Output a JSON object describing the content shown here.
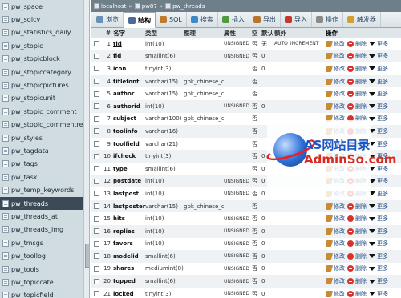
{
  "sidebar": {
    "items": [
      "pw_space",
      "pw_sqlcv",
      "pw_statistics_daily",
      "pw_stopic",
      "pw_stopicblock",
      "pw_stopiccategory",
      "pw_stopicpictures",
      "pw_stopicunit",
      "pw_stopic_comment",
      "pw_stopic_commentre",
      "pw_styles",
      "pw_tagdata",
      "pw_tags",
      "pw_task",
      "pw_temp_keywords",
      "pw_threads",
      "pw_threads_at",
      "pw_threads_img",
      "pw_tmsgs",
      "pw_toollog",
      "pw_tools",
      "pw_topiccate",
      "pw_topicfield"
    ],
    "selected_index": 15
  },
  "breadcrumb": {
    "server": "localhost",
    "database": "pw87",
    "table": "pw_threads",
    "sep": "»"
  },
  "tabs": [
    "浏览",
    "结构",
    "SQL",
    "搜索",
    "插入",
    "导出",
    "导入",
    "操作",
    "触发器"
  ],
  "active_tab": 1,
  "columns": {
    "num": "#",
    "name": "名字",
    "type": "类型",
    "collation": "整理",
    "attributes": "属性",
    "null": "空",
    "default": "默认",
    "extra": "额外",
    "action": "操作"
  },
  "actions": {
    "edit": "修改",
    "delete": "删除",
    "more": "更多"
  },
  "rows": [
    {
      "num": "1",
      "name": "tid",
      "type": "int(10)",
      "coll": "",
      "attr": "UNSIGNED",
      "null": "否",
      "def": "无",
      "extra": "AUTO_INCREMENT"
    },
    {
      "num": "2",
      "name": "fid",
      "type": "smallint(6)",
      "coll": "",
      "attr": "UNSIGNED",
      "null": "否",
      "def": "0",
      "extra": ""
    },
    {
      "num": "3",
      "name": "icon",
      "type": "tinyint(3)",
      "coll": "",
      "attr": "",
      "null": "否",
      "def": "0",
      "extra": ""
    },
    {
      "num": "4",
      "name": "titlefont",
      "type": "varchar(15)",
      "coll": "gbk_chinese_ci",
      "attr": "",
      "null": "否",
      "def": "",
      "extra": ""
    },
    {
      "num": "5",
      "name": "author",
      "type": "varchar(15)",
      "coll": "gbk_chinese_ci",
      "attr": "",
      "null": "否",
      "def": "",
      "extra": ""
    },
    {
      "num": "6",
      "name": "authorid",
      "type": "int(10)",
      "coll": "",
      "attr": "UNSIGNED",
      "null": "否",
      "def": "0",
      "extra": ""
    },
    {
      "num": "7",
      "name": "subject",
      "type": "varchar(100)",
      "coll": "gbk_chinese_ci",
      "attr": "",
      "null": "否",
      "def": "",
      "extra": ""
    },
    {
      "num": "8",
      "name": "toolinfo",
      "type": "varchar(16)",
      "coll": "",
      "attr": "",
      "null": "否",
      "def": "",
      "extra": ""
    },
    {
      "num": "9",
      "name": "toolfield",
      "type": "varchar(21)",
      "coll": "",
      "attr": "",
      "null": "否",
      "def": "",
      "extra": ""
    },
    {
      "num": "10",
      "name": "ifcheck",
      "type": "tinyint(3)",
      "coll": "",
      "attr": "",
      "null": "否",
      "def": "0",
      "extra": ""
    },
    {
      "num": "11",
      "name": "type",
      "type": "smallint(6)",
      "coll": "",
      "attr": "",
      "null": "否",
      "def": "0",
      "extra": ""
    },
    {
      "num": "12",
      "name": "postdate",
      "type": "int(10)",
      "coll": "",
      "attr": "UNSIGNED",
      "null": "否",
      "def": "0",
      "extra": ""
    },
    {
      "num": "13",
      "name": "lastpost",
      "type": "int(10)",
      "coll": "",
      "attr": "UNSIGNED",
      "null": "否",
      "def": "0",
      "extra": ""
    },
    {
      "num": "14",
      "name": "lastposter",
      "type": "varchar(15)",
      "coll": "gbk_chinese_ci",
      "attr": "",
      "null": "否",
      "def": "",
      "extra": ""
    },
    {
      "num": "15",
      "name": "hits",
      "type": "int(10)",
      "coll": "",
      "attr": "UNSIGNED",
      "null": "否",
      "def": "0",
      "extra": ""
    },
    {
      "num": "16",
      "name": "replies",
      "type": "int(10)",
      "coll": "",
      "attr": "UNSIGNED",
      "null": "否",
      "def": "0",
      "extra": ""
    },
    {
      "num": "17",
      "name": "favors",
      "type": "int(10)",
      "coll": "",
      "attr": "UNSIGNED",
      "null": "否",
      "def": "0",
      "extra": ""
    },
    {
      "num": "18",
      "name": "modelid",
      "type": "smallint(6)",
      "coll": "",
      "attr": "UNSIGNED",
      "null": "否",
      "def": "0",
      "extra": ""
    },
    {
      "num": "19",
      "name": "shares",
      "type": "mediumint(8)",
      "coll": "",
      "attr": "UNSIGNED",
      "null": "否",
      "def": "0",
      "extra": ""
    },
    {
      "num": "20",
      "name": "topped",
      "type": "smallint(6)",
      "coll": "",
      "attr": "UNSIGNED",
      "null": "否",
      "def": "0",
      "extra": ""
    },
    {
      "num": "21",
      "name": "locked",
      "type": "tinyint(3)",
      "coll": "",
      "attr": "UNSIGNED",
      "null": "否",
      "def": "0",
      "extra": ""
    }
  ],
  "watermark": {
    "line1": "AS网站目录",
    "line2": "AdminSo.com"
  },
  "colors": {
    "tab_text": "#1d3b5c",
    "action_text": "#234f86",
    "delete_icon": "#d8322d",
    "sidebar_bg": "#d0dce0"
  }
}
